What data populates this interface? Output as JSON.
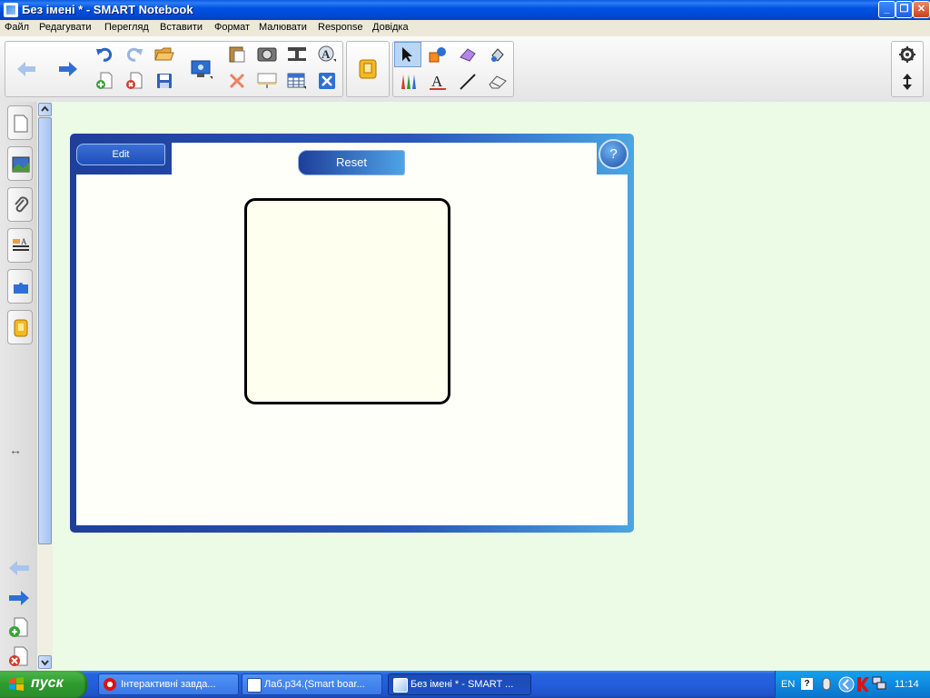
{
  "window": {
    "title": "Без імені * - SMART Notebook",
    "controls": [
      "minimize-icon",
      "restore-icon",
      "close-icon"
    ]
  },
  "menu": {
    "items": [
      "Файл",
      "Редагувати",
      "Перегляд",
      "Вставити",
      "Формат",
      "Малювати",
      "Response",
      "Довідка"
    ]
  },
  "toolbar": {
    "icons": [
      "back-arrow-icon",
      "forward-arrow-icon",
      "undo-icon",
      "redo-icon",
      "open-folder-icon",
      "add-page-icon",
      "delete-page-icon",
      "save-icon",
      "screen-shade-icon",
      "paste-icon",
      "screen-capture-icon",
      "insert-table-icon",
      "fonts-icon",
      "delete-icon",
      "screen-display-icon",
      "table-icon",
      "fullscreen-icon",
      "response-icon",
      "select-icon",
      "shapes-icon",
      "magic-pen-icon",
      "fill-icon",
      "pens-icon",
      "text-icon",
      "line-icon",
      "eraser-icon",
      "settings-icon",
      "move-toolbar-icon"
    ]
  },
  "side_tabs": [
    "page-sorter-icon",
    "gallery-icon",
    "attachments-icon",
    "properties-icon",
    "addons-icon",
    "response-tab-icon"
  ],
  "widget": {
    "edit_label": "Edit",
    "reset_label": "Reset",
    "help_label": "?"
  },
  "taskbar": {
    "start_label": "пуск",
    "tasks": [
      {
        "label": "Інтерактивні завда...",
        "icon": "opera-icon"
      },
      {
        "label": "Лаб.р34.(Smart boar...",
        "icon": "word-icon"
      },
      {
        "label": "Без імені * - SMART ...",
        "icon": "notebook-icon"
      }
    ],
    "tray": {
      "language": "EN",
      "clock": "11:14"
    }
  },
  "colors": {
    "titlebar": "#0054e3",
    "canvas_bg": "#ebfbe6",
    "widget_frame": "#2a56b8",
    "taskbar": "#245edb",
    "start_green": "#3aa33a"
  }
}
